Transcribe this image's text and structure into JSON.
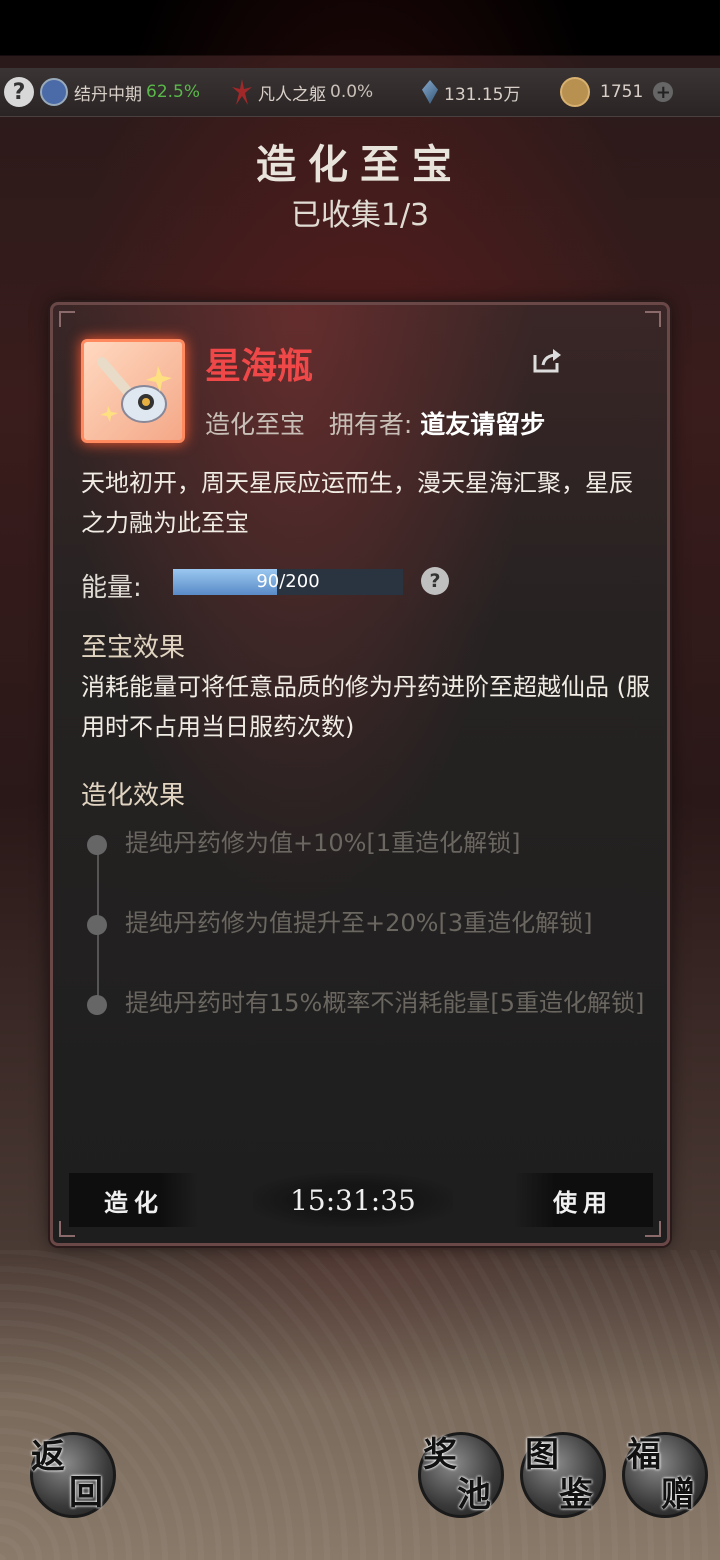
{
  "topbar": {
    "realm": "结丹中期",
    "realm_pct": "62.5%",
    "body": "凡人之躯",
    "body_pct": "0.0%",
    "stones": "131.15万",
    "coins": "1751"
  },
  "header": {
    "title": "造化至宝",
    "collected": "已收集1/3"
  },
  "item": {
    "name": "星海瓶",
    "category": "造化至宝",
    "owner_label": "拥有者:",
    "owner": "道友请留步",
    "description": "天地初开，周天星辰应运而生，漫天星海汇聚，星辰之力融为此至宝"
  },
  "energy": {
    "label": "能量:",
    "current": "90",
    "text": "90/200",
    "fraction": 0.45
  },
  "effect": {
    "title": "至宝效果",
    "text": "消耗能量可将任意品质的修为丹药进阶至超越仙品 (服用时不占用当日服药次数)"
  },
  "refine": {
    "title": "造化效果",
    "items": [
      "提纯丹药修为值+10%[1重造化解锁]",
      "提纯丹药修为值提升至+20%[3重造化解锁]",
      "提纯丹药时有15%概率不消耗能量[5重造化解锁]"
    ]
  },
  "actions": {
    "refine_button": "造化",
    "timer": "15:31:35",
    "use_button": "使用"
  },
  "bottom": {
    "back": [
      "返",
      "回"
    ],
    "pool": [
      "奖",
      "池"
    ],
    "atlas": [
      "图",
      "鉴"
    ],
    "gift": [
      "福",
      "赠"
    ]
  },
  "colors": {
    "item_name": "#f04848",
    "rarity_frame": "#ff8a60",
    "energy_fill": "#5a8ac8",
    "realm_pct": "#5ab84a"
  }
}
